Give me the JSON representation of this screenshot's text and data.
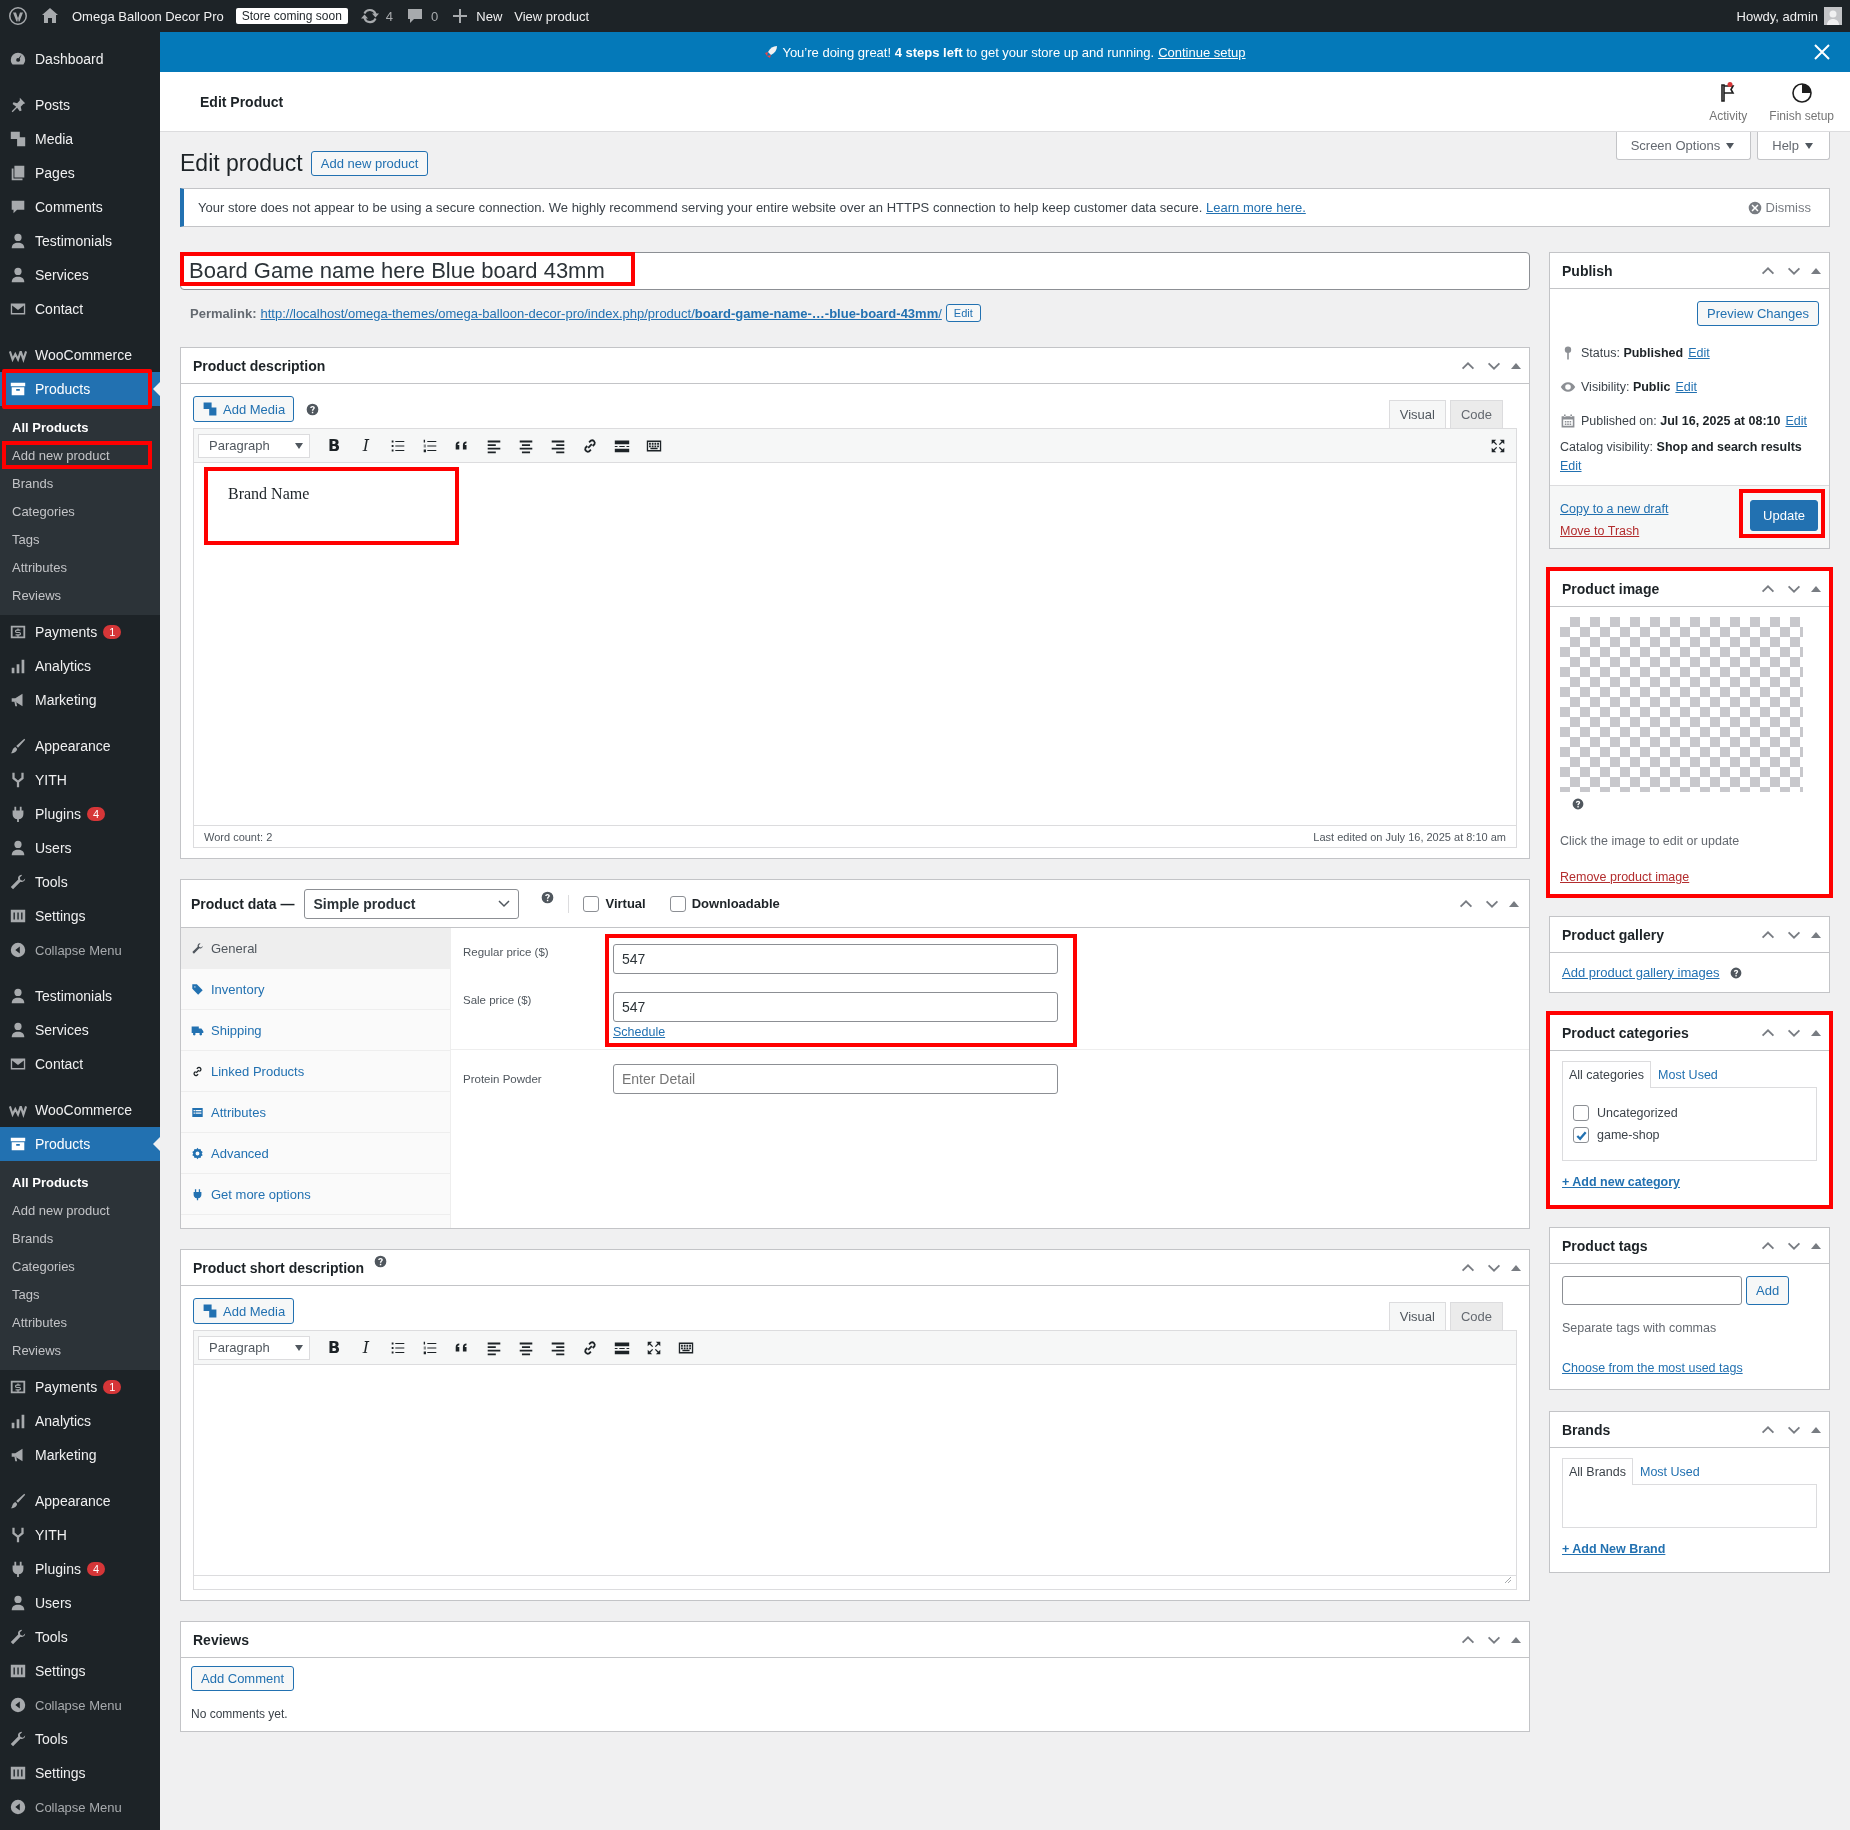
{
  "admin_bar": {
    "site_name": "Omega Balloon Decor Pro",
    "store_badge": "Store coming soon",
    "updates_count": "4",
    "comments_count": "0",
    "new_label": "New",
    "view_label": "View product",
    "greeting": "Howdy, admin"
  },
  "sidebar": {
    "groups": [
      [
        {
          "label": "Dashboard",
          "kind": "menu",
          "selected": false
        }
      ],
      [
        {
          "label": "Posts",
          "kind": "menu",
          "selected": false
        },
        {
          "label": "Media",
          "kind": "menu",
          "selected": false
        },
        {
          "label": "Pages",
          "kind": "menu",
          "selected": false
        },
        {
          "label": "Comments",
          "kind": "menu",
          "selected": false
        },
        {
          "label": "Testimonials",
          "kind": "menu",
          "selected": false
        },
        {
          "label": "Services",
          "kind": "menu",
          "selected": false
        },
        {
          "label": "Contact",
          "kind": "menu",
          "selected": false
        }
      ],
      [
        {
          "label": "WooCommerce",
          "kind": "menu",
          "selected": false
        },
        {
          "label": "Products",
          "kind": "menu",
          "selected": true,
          "highlighted": true,
          "children": [
            {
              "label": "All Products",
              "selected": true
            },
            {
              "label": "Add new product",
              "selected": false,
              "highlighted": true
            },
            {
              "label": "Brands",
              "selected": false
            },
            {
              "label": "Categories",
              "selected": false
            },
            {
              "label": "Tags",
              "selected": false
            },
            {
              "label": "Attributes",
              "selected": false
            },
            {
              "label": "Reviews",
              "selected": false
            }
          ]
        },
        {
          "label": "Payments",
          "kind": "menu",
          "selected": false,
          "badge": "1"
        },
        {
          "label": "Analytics",
          "kind": "menu",
          "selected": false
        },
        {
          "label": "Marketing",
          "kind": "menu",
          "selected": false
        }
      ],
      [
        {
          "label": "Appearance",
          "kind": "menu",
          "selected": false
        },
        {
          "label": "YITH",
          "kind": "menu",
          "selected": false
        },
        {
          "label": "Plugins",
          "kind": "menu",
          "selected": false,
          "badge": "4"
        },
        {
          "label": "Users",
          "kind": "menu",
          "selected": false
        },
        {
          "label": "Tools",
          "kind": "menu",
          "selected": false
        },
        {
          "label": "Settings",
          "kind": "menu",
          "selected": false
        },
        {
          "label": "Collapse Menu",
          "kind": "collapse",
          "selected": false
        }
      ],
      [
        {
          "label": "Testimonials",
          "kind": "menu",
          "selected": false
        },
        {
          "label": "Services",
          "kind": "menu",
          "selected": false
        },
        {
          "label": "Contact",
          "kind": "menu",
          "selected": false
        }
      ],
      [
        {
          "label": "WooCommerce",
          "kind": "menu",
          "selected": false
        },
        {
          "label": "Products",
          "kind": "menu",
          "selected": true,
          "children": [
            {
              "label": "All Products",
              "selected": true
            },
            {
              "label": "Add new product",
              "selected": false
            },
            {
              "label": "Brands",
              "selected": false
            },
            {
              "label": "Categories",
              "selected": false
            },
            {
              "label": "Tags",
              "selected": false
            },
            {
              "label": "Attributes",
              "selected": false
            },
            {
              "label": "Reviews",
              "selected": false
            }
          ]
        },
        {
          "label": "Payments",
          "kind": "menu",
          "selected": false,
          "badge": "1"
        },
        {
          "label": "Analytics",
          "kind": "menu",
          "selected": false
        },
        {
          "label": "Marketing",
          "kind": "menu",
          "selected": false
        }
      ],
      [
        {
          "label": "Appearance",
          "kind": "menu",
          "selected": false
        },
        {
          "label": "YITH",
          "kind": "menu",
          "selected": false
        },
        {
          "label": "Plugins",
          "kind": "menu",
          "selected": false,
          "badge": "4"
        },
        {
          "label": "Users",
          "kind": "menu",
          "selected": false
        },
        {
          "label": "Tools",
          "kind": "menu",
          "selected": false
        },
        {
          "label": "Settings",
          "kind": "menu",
          "selected": false
        },
        {
          "label": "Collapse Menu",
          "kind": "collapse",
          "selected": false
        },
        {
          "label": "Tools",
          "kind": "menu",
          "selected": false
        },
        {
          "label": "Settings",
          "kind": "menu",
          "selected": false
        },
        {
          "label": "Collapse Menu",
          "kind": "collapse",
          "selected": false
        }
      ]
    ]
  },
  "banner": {
    "text": "You’re doing great! **4 steps left** to get your store up and running.",
    "link": "Continue setup"
  },
  "header": {
    "title": "Edit Product",
    "actions": [
      "Activity",
      "Finish setup"
    ]
  },
  "screen_meta": [
    "Screen Options",
    "Help"
  ],
  "heading": {
    "title": "Edit product",
    "add_button": "Add new product"
  },
  "notice": {
    "text": "Your store does not appear to be using a secure connection. We highly recommend serving your entire website over an HTTPS connection to help keep customer data secure.",
    "link": "Learn more here.",
    "dismiss": "Dismiss"
  },
  "title_field": {
    "value": "Board Game name here Blue board 43mm",
    "highlighted": true
  },
  "permalink": {
    "label": "Permalink:",
    "url": "http://localhost/omega-themes/omega-balloon-decor-pro/index.php/product/**board-game-name-…-blue-board-43mm**/",
    "edit": "Edit"
  },
  "description": {
    "title": "Product description",
    "add_media": "Add Media",
    "tabs": [
      {
        "label": "Visual",
        "selected": true
      },
      {
        "label": "Code",
        "selected": false
      }
    ],
    "format": "Paragraph",
    "toolbar": [
      {
        "kind": "bold",
        "text": "B"
      },
      {
        "kind": "italic",
        "text": "I"
      },
      {
        "kind": "bullets"
      },
      {
        "kind": "numbers"
      },
      {
        "kind": "quote"
      },
      {
        "kind": "align-left"
      },
      {
        "kind": "align-center"
      },
      {
        "kind": "align-right"
      },
      {
        "kind": "link"
      },
      {
        "kind": "more"
      },
      {
        "kind": "toggle"
      }
    ],
    "side_tools": [
      {
        "kind": "fullscreen"
      }
    ],
    "content": "Brand Name",
    "content_highlighted": true,
    "word_count": "Word count: 2",
    "last_edited": "Last edited on July 16, 2025 at 8:10 am"
  },
  "product_data": {
    "title": "Product data —",
    "type": "Simple product",
    "options": [
      {
        "label": "Virtual",
        "checked": false
      },
      {
        "label": "Downloadable",
        "checked": false
      }
    ],
    "tabs": [
      {
        "label": "General",
        "selected": true
      },
      {
        "label": "Inventory",
        "selected": false
      },
      {
        "label": "Shipping",
        "selected": false
      },
      {
        "label": "Linked Products",
        "selected": false
      },
      {
        "label": "Attributes",
        "selected": false
      },
      {
        "label": "Advanced",
        "selected": false
      },
      {
        "label": "Get more options",
        "selected": false
      }
    ],
    "prices": [
      {
        "label": "Regular price ($)",
        "value": "547"
      },
      {
        "label": "Sale price ($)",
        "value": "547"
      }
    ],
    "schedule": "Schedule",
    "prices_highlighted": true,
    "extra_fields": [
      {
        "label": "Protein Powder",
        "placeholder": "Enter Detail"
      }
    ]
  },
  "short_description": {
    "title": "Product short description",
    "add_media": "Add Media",
    "tabs": [
      {
        "label": "Visual",
        "selected": true
      },
      {
        "label": "Code",
        "selected": false
      }
    ],
    "format": "Paragraph",
    "toolbar": [
      {
        "kind": "bold",
        "text": "B"
      },
      {
        "kind": "italic",
        "text": "I"
      },
      {
        "kind": "bullets"
      },
      {
        "kind": "numbers"
      },
      {
        "kind": "quote"
      },
      {
        "kind": "align-left"
      },
      {
        "kind": "align-center"
      },
      {
        "kind": "align-right"
      },
      {
        "kind": "link"
      },
      {
        "kind": "more"
      },
      {
        "kind": "fullscreen"
      },
      {
        "kind": "toggle"
      }
    ]
  },
  "reviews": {
    "title": "Reviews",
    "button": "Add Comment",
    "empty": "No comments yet."
  },
  "publish": {
    "title": "Publish",
    "preview": "Preview Changes",
    "rows": [
      {
        "text": "Status: **Published**",
        "edit": "Edit"
      },
      {
        "text": "Visibility: **Public**",
        "edit": "Edit"
      },
      {
        "text": "Published on: **Jul 16, 2025 at 08:10**",
        "edit": "Edit"
      },
      {
        "text": "Catalog visibility: **Shop and search results**",
        "edit": "Edit"
      }
    ],
    "copy": "Copy to a new draft",
    "trash": "Move to Trash",
    "update": "Update",
    "update_highlighted": true
  },
  "product_image": {
    "title": "Product image",
    "hint": "Click the image to edit or update",
    "remove": "Remove product image",
    "highlighted": true
  },
  "gallery": {
    "title": "Product gallery",
    "link": "Add product gallery images"
  },
  "categories": {
    "title": "Product categories",
    "tabs": [
      {
        "label": "All categories",
        "selected": true
      },
      {
        "label": "Most Used",
        "selected": false
      }
    ],
    "items": [
      {
        "label": "Uncategorized",
        "checked": false
      },
      {
        "label": "game-shop",
        "checked": true
      }
    ],
    "add": "+ Add new category",
    "highlighted": true
  },
  "tags": {
    "title": "Product tags",
    "add": "Add",
    "hint": "Separate tags with commas",
    "link": "Choose from the most used tags"
  },
  "brands": {
    "title": "Brands",
    "tabs": [
      {
        "label": "All Brands",
        "selected": true
      },
      {
        "label": "Most Used",
        "selected": false
      }
    ],
    "add": "+ Add New Brand"
  }
}
